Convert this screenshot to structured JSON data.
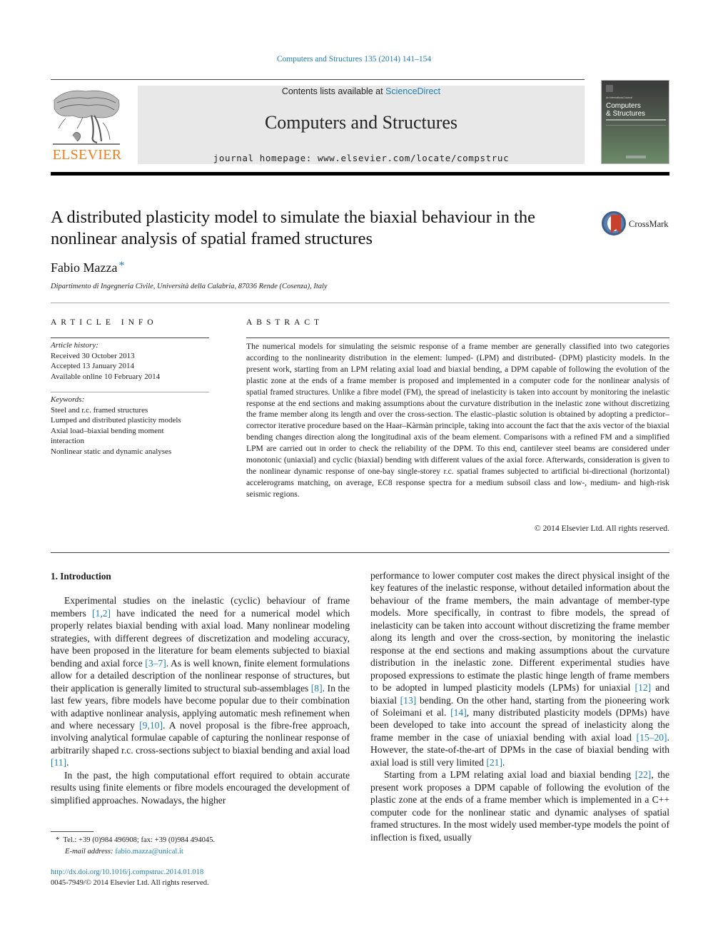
{
  "header": {
    "journal_ref": "Computers and Structures 135 (2014) 141–154",
    "contents_prefix": "Contents lists available at ",
    "contents_link": "ScienceDirect",
    "journal_title": "Computers and Structures",
    "homepage": "journal homepage: www.elsevier.com/locate/compstruc",
    "publisher_logo_text": "ELSEVIER",
    "cover": {
      "small_text": "An International Journal",
      "title_line1": "Computers",
      "title_line2": "& Structures"
    },
    "colors": {
      "link": "#1f7fb3",
      "elsevier_orange": "#f07e1b",
      "banner_bg": "#e8e8e8"
    }
  },
  "article": {
    "title": "A distributed plasticity model to simulate the biaxial behaviour in the nonlinear analysis of spatial framed structures",
    "crossmark_label": "CrossMark",
    "author": "Fabio Mazza",
    "author_mark": "*",
    "affiliation": "Dipartimento di Ingegneria Civile, Università della Calabria, 87036 Rende (Cosenza), Italy"
  },
  "article_info": {
    "heading": "ARTICLE INFO",
    "history_label": "Article history:",
    "history": [
      "Received 30 October 2013",
      "Accepted 13 January 2014",
      "Available online 10 February 2014"
    ],
    "keywords_label": "Keywords:",
    "keywords": [
      "Steel and r.c. framed structures",
      "Lumped and distributed plasticity models",
      "Axial load–biaxial bending moment interaction",
      "Nonlinear static and dynamic analyses"
    ]
  },
  "abstract": {
    "heading": "ABSTRACT",
    "text": "The numerical models for simulating the seismic response of a frame member are generally classified into two categories according to the nonlinearity distribution in the element: lumped- (LPM) and distributed- (DPM) plasticity models. In the present work, starting from an LPM relating axial load and biaxial bending, a DPM capable of following the evolution of the plastic zone at the ends of a frame member is proposed and implemented in a computer code for the nonlinear analysis of spatial framed structures. Unlike a fibre model (FM), the spread of inelasticity is taken into account by monitoring the inelastic response at the end sections and making assumptions about the curvature distribution in the inelastic zone without discretizing the frame member along its length and over the cross-section. The elastic–plastic solution is obtained by adopting a predictor–corrector iterative procedure based on the Haar–Kàrmàn principle, taking into account the fact that the axis vector of the biaxial bending changes direction along the longitudinal axis of the beam element. Comparisons with a refined FM and a simplified LPM are carried out in order to check the reliability of the DPM. To this end, cantilever steel beams are considered under monotonic (uniaxial) and cyclic (biaxial) bending with different values of the axial force. Afterwards, consideration is given to the nonlinear dynamic response of one-bay single-storey r.c. spatial frames subjected to artificial bi-directional (horizontal) accelerograms matching, on average, EC8 response spectra for a medium subsoil class and low-, medium- and high-risk seismic regions.",
    "copyright": "© 2014 Elsevier Ltd. All rights reserved."
  },
  "body": {
    "section_title": "1. Introduction",
    "left_paragraphs": [
      [
        {
          "t": "Experimental studies on the inelastic (cyclic) behaviour of frame members "
        },
        {
          "c": "[1,2]"
        },
        {
          "t": " have indicated the need for a numerical model which properly relates biaxial bending with axial load. Many nonlinear modeling strategies, with different degrees of discretization and modeling accuracy, have been proposed in the literature for beam elements subjected to biaxial bending and axial force "
        },
        {
          "c": "[3–7]"
        },
        {
          "t": ". As is well known, finite element formulations allow for a detailed description of the nonlinear response of structures, but their application is generally limited to structural sub-assemblages "
        },
        {
          "c": "[8]"
        },
        {
          "t": ". In the last few years, fibre models have become popular due to their combination with adaptive nonlinear analysis, applying automatic mesh refinement when and where necessary "
        },
        {
          "c": "[9,10]"
        },
        {
          "t": ". A novel proposal is the fibre-free approach, involving analytical formulae capable of capturing the nonlinear response of arbitrarily shaped r.c. cross-sections subject to biaxial bending and axial load "
        },
        {
          "c": "[11]"
        },
        {
          "t": "."
        }
      ],
      [
        {
          "t": "In the past, the high computational effort required to obtain accurate results using finite elements or fibre models encouraged the development of simplified approaches. Nowadays, the higher"
        }
      ]
    ],
    "right_paragraphs": [
      [
        {
          "t": "performance to lower computer cost makes the direct physical insight of the key features of the inelastic response, without detailed information about the behaviour of the frame members, the main advantage of member-type models. More specifically, in contrast to fibre models, the spread of inelasticity can be taken into account without discretizing the frame member along its length and over the cross-section, by monitoring the inelastic response at the end sections and making assumptions about the curvature distribution in the inelastic zone. Different experimental studies have proposed expressions to estimate the plastic hinge length of frame members to be adopted in lumped plasticity models (LPMs) for uniaxial "
        },
        {
          "c": "[12]"
        },
        {
          "t": " and biaxial "
        },
        {
          "c": "[13]"
        },
        {
          "t": " bending. On the other hand, starting from the pioneering work of Soleimani et al. "
        },
        {
          "c": "[14]"
        },
        {
          "t": ", many distributed plasticity models (DPMs) have been developed to take into account the spread of inelasticity along the frame member in the case of uniaxial bending with axial load "
        },
        {
          "c": "[15–20]"
        },
        {
          "t": ". However, the state-of-the-art of DPMs in the case of biaxial bending with axial load is still very limited "
        },
        {
          "c": "[21]"
        },
        {
          "t": "."
        }
      ],
      [
        {
          "t": "Starting from a LPM relating axial load and biaxial bending "
        },
        {
          "c": "[22]"
        },
        {
          "t": ", the present work proposes a DPM capable of following the evolution of the plastic zone at the ends of a frame member which is implemented in a C++ computer code for the nonlinear static and dynamic analyses of spatial framed structures. In the most widely used member-type models the point of inflection is fixed, usually"
        }
      ]
    ]
  },
  "footnote": {
    "mark": "*",
    "contact": "Tel.: +39 (0)984 496908; fax: +39 (0)984 494045.",
    "email_label": "E-mail address:",
    "email": "fabio.mazza@unical.it",
    "doi": "http://dx.doi.org/10.1016/j.compstruc.2014.01.018",
    "issn_line": "0045-7949/© 2014 Elsevier Ltd. All rights reserved."
  }
}
